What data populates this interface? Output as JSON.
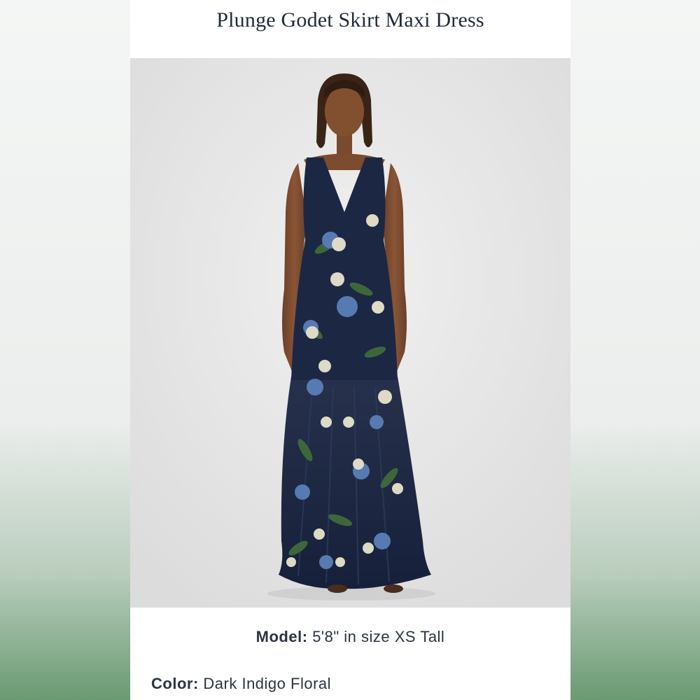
{
  "product": {
    "title": "Plunge Godet Skirt Maxi Dress"
  },
  "image": {
    "alt": "Model wearing the dark indigo floral plunge godet skirt maxi dress"
  },
  "details": {
    "model_label": "Model:",
    "model_value": "5'8\" in size XS Tall",
    "color_label": "Color:",
    "color_value": "Dark Indigo Floral"
  },
  "colors": {
    "dress": "#1c2744",
    "accent_green": "#6a9a72"
  }
}
